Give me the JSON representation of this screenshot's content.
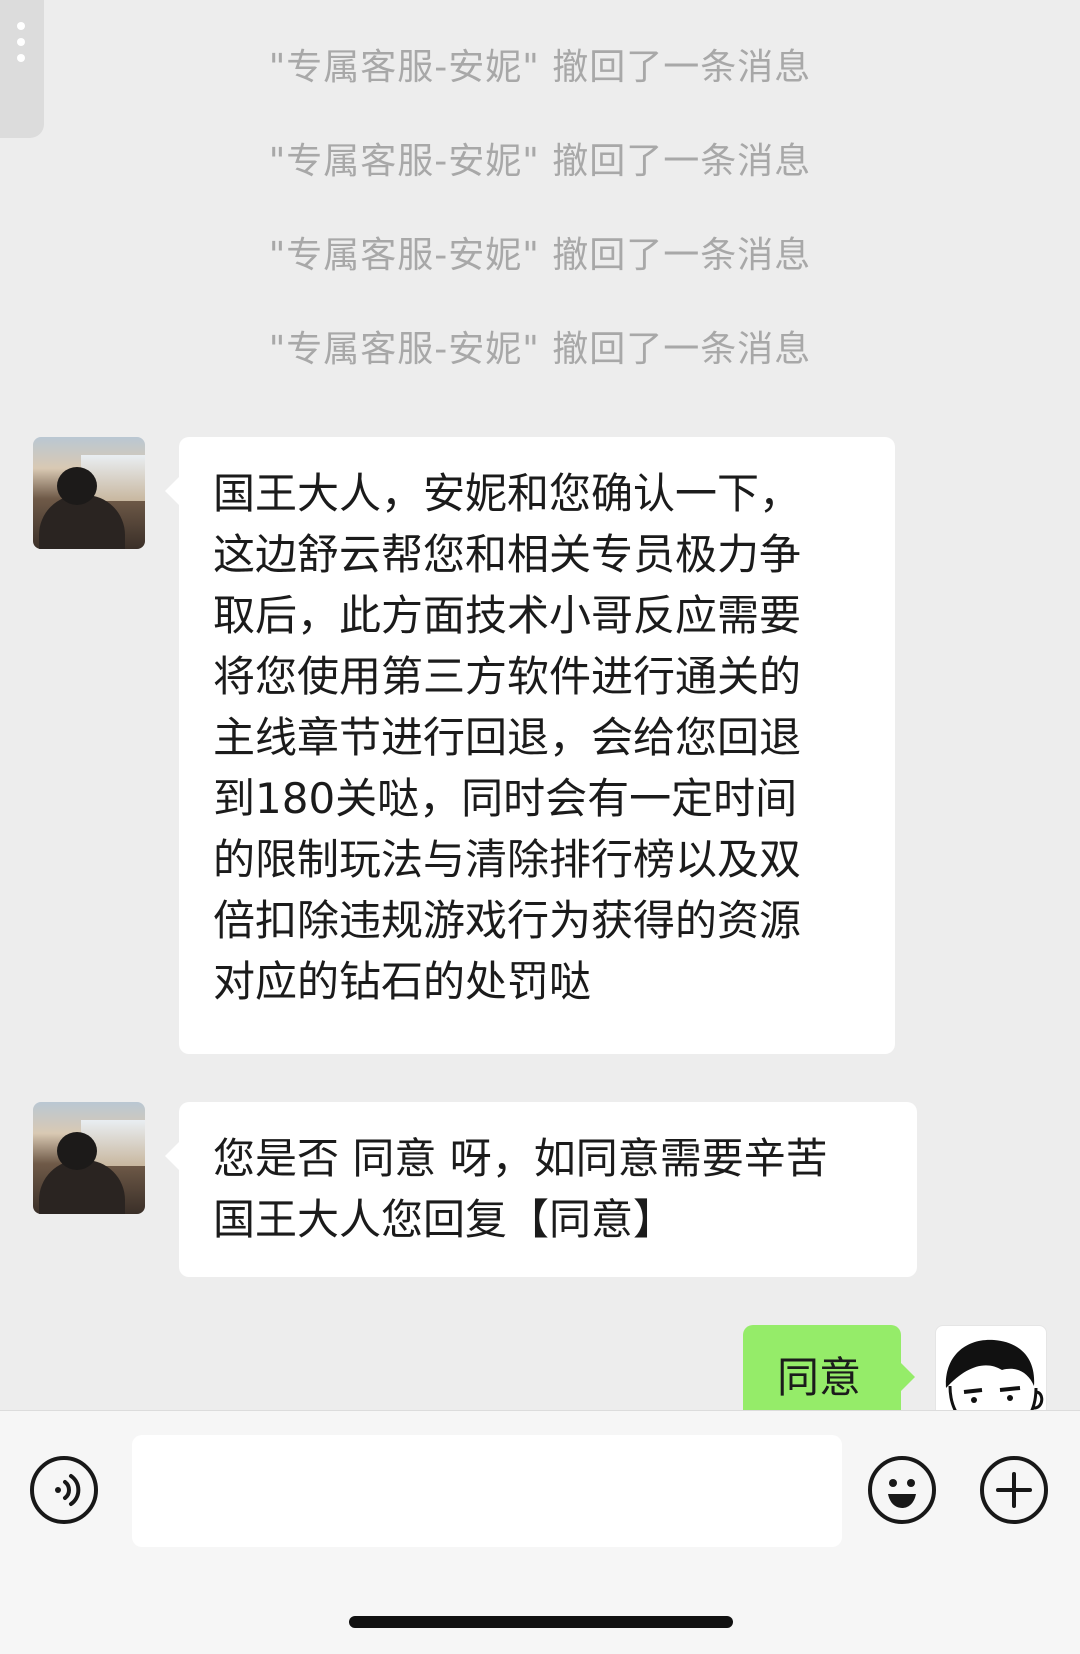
{
  "recall_notices": [
    "\"专属客服-安妮\" 撤回了一条消息",
    "\"专属客服-安妮\" 撤回了一条消息",
    "\"专属客服-安妮\" 撤回了一条消息",
    "\"专属客服-安妮\" 撤回了一条消息"
  ],
  "messages": {
    "agent_1_lines": [
      "国王大人，安妮和您确认一下，",
      "这边舒云帮您和相关专员极力争",
      "取后，此方面技术小哥反应需要",
      "将您使用第三方软件进行通关的",
      "主线章节进行回退，会给您回退",
      "到180关哒，同时会有一定时间",
      "的限制玩法与清除排行榜以及双",
      "倍扣除违规游戏行为获得的资源",
      "对应的钻石的处罚哒"
    ],
    "agent_2_lines": [
      "您是否 同意 呀，如同意需要辛苦",
      "国王大人您回复【同意】"
    ],
    "me_1": "同意"
  },
  "input": {
    "value": "",
    "placeholder": ""
  },
  "icons": {
    "voice": "voice-icon",
    "emoji": "emoji-icon",
    "add": "plus-icon",
    "more": "more-dots-icon"
  },
  "colors": {
    "background": "#ededed",
    "bubble_in": "#ffffff",
    "bubble_out": "#95ec69",
    "recall_text": "#a8a8a8"
  }
}
